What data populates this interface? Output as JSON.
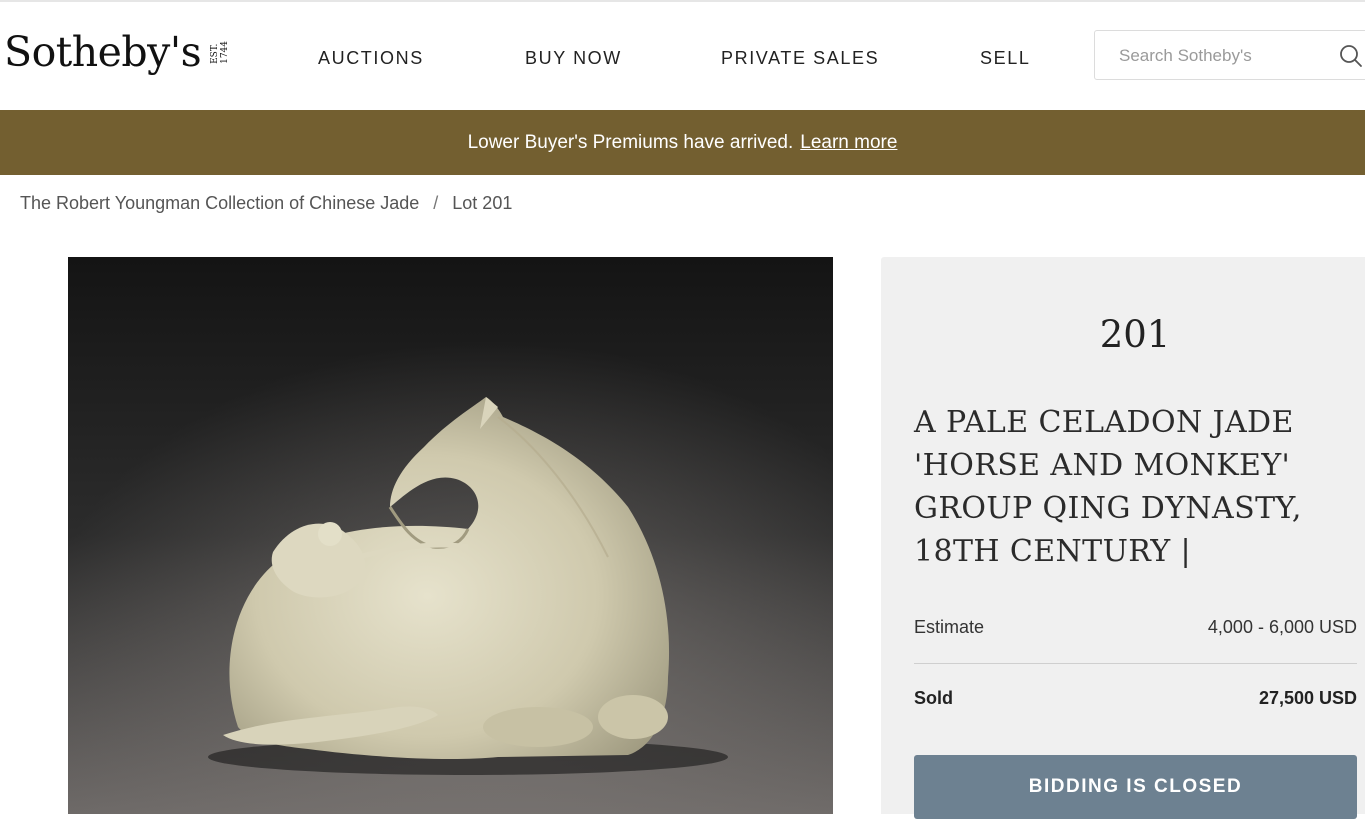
{
  "header": {
    "logo_text": "Sotheby's",
    "logo_est": [
      "EST.",
      "1744"
    ],
    "nav": [
      {
        "label": "AUCTIONS"
      },
      {
        "label": "BUY NOW"
      },
      {
        "label": "PRIVATE SALES"
      },
      {
        "label": "SELL"
      }
    ],
    "search": {
      "placeholder": "Search Sotheby's",
      "value": ""
    }
  },
  "banner": {
    "text": "Lower Buyer's Premiums have arrived.",
    "link_label": "Learn more",
    "background_color": "#735f30"
  },
  "breadcrumb": {
    "items": [
      "The Robert Youngman Collection of Chinese Jade",
      "Lot 201"
    ],
    "separator": "/"
  },
  "lot": {
    "image_icon": "jade-horse-and-monkey-photo",
    "number": "201",
    "title": "A PALE CELADON JADE 'HORSE AND MONKEY' GROUP QING DYNASTY, 18TH CENTURY |",
    "estimate_label": "Estimate",
    "estimate_value": "4,000 - 6,000 USD",
    "sold_label": "Sold",
    "sold_value": "27,500 USD",
    "button_label": "BIDDING IS CLOSED",
    "button_color": "#6d8191"
  }
}
